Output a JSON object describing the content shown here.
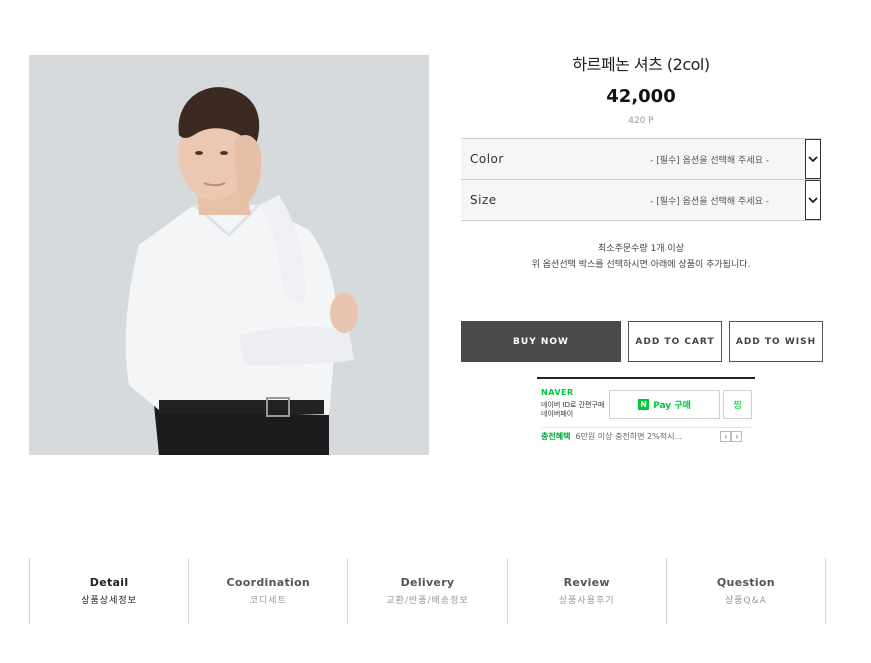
{
  "product": {
    "title": "하르페논 셔츠 (2col)",
    "price": "42,000",
    "points": "420 P"
  },
  "options": [
    {
      "label": "Color",
      "placeholder": "- [필수] 옵션을 선택해 주세요 -"
    },
    {
      "label": "Size",
      "placeholder": "- [필수] 옵션을 선택해 주세요 -"
    }
  ],
  "notice": {
    "min_qty": "최소주문수량 1개 이상",
    "hint": "위 옵션선택 박스를 선택하시면 아래에 상품이 추가됩니다."
  },
  "actions": {
    "buy_now": "BUY NOW",
    "add_to_cart": "ADD TO CART",
    "add_to_wish": "ADD TO WISH"
  },
  "npay": {
    "logo": "NAVER",
    "desc": "네이버 ID로 간편구매 네이버페이",
    "button_n": "N",
    "button_label": "Pay 구매",
    "zzim": "찜",
    "benefit_label": "충전혜택",
    "benefit_text": "6만원 이상 충전하면 2%적시...",
    "prev": "‹",
    "next": "›"
  },
  "tabs": [
    {
      "en": "Detail",
      "ko": "상품상세정보"
    },
    {
      "en": "Coordination",
      "ko": "코디세트"
    },
    {
      "en": "Delivery",
      "ko": "교환/반품/배송정보"
    },
    {
      "en": "Review",
      "ko": "상품사용후기"
    },
    {
      "en": "Question",
      "ko": "상품Q&A"
    }
  ],
  "colors": {
    "buy_bg": "#4a4a4a",
    "npay_green": "#00c73c",
    "photo_bg": "#d6dadd"
  }
}
